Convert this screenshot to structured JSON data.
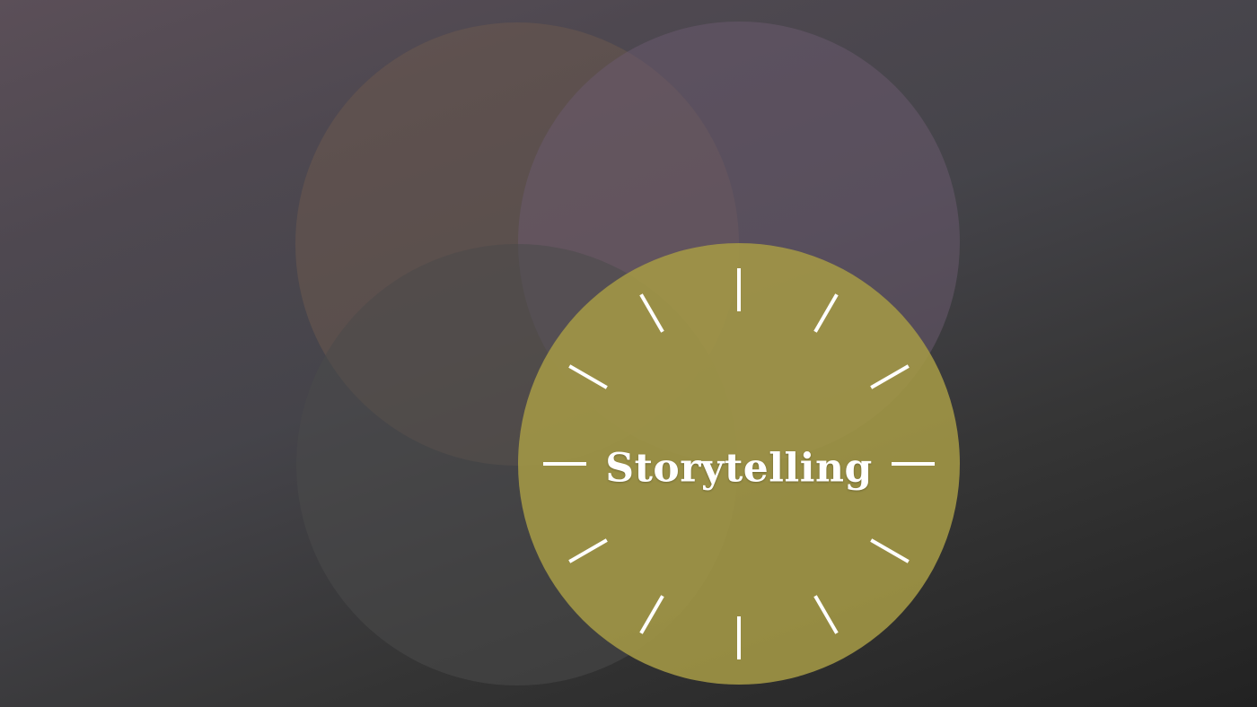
{
  "slide": {
    "title": "Storytelling"
  },
  "colors": {
    "background_top": "#5b4f58",
    "background_bottom": "#222222",
    "circle_top_left": "#6e5a4e",
    "circle_top_right": "#6a5a6e",
    "circle_bottom_left": "#4a4a4a",
    "circle_main": "#a49845",
    "ticks": "#ffffff",
    "title": "#ffffff"
  },
  "clock_face": {
    "tick_count": 12
  }
}
